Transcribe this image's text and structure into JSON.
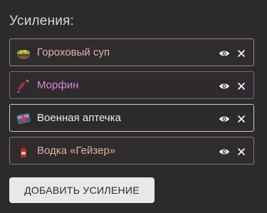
{
  "panel": {
    "title": "Усиления:"
  },
  "boosts": [
    {
      "label": "Гороховый суп",
      "icon": "pea-soup-icon",
      "color": "#e0b3a8"
    },
    {
      "label": "Морфин",
      "icon": "morphine-syringe-icon",
      "color": "#d48bd4"
    },
    {
      "label": "Военная аптечка",
      "icon": "military-medkit-icon",
      "color": "#ededed"
    },
    {
      "label": "Водка «Гейзер»",
      "icon": "vodka-bottle-icon",
      "color": "#e4aea5"
    }
  ],
  "actions": {
    "add_label": "ДОБАВИТЬ УСИЛЕНИЕ"
  }
}
